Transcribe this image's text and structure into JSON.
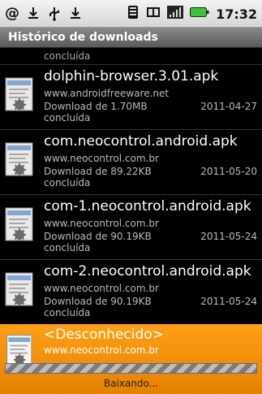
{
  "status_bar": {
    "time": "17:32",
    "left_icons": [
      "at-icon",
      "download-icon",
      "usb-icon",
      "download-icon"
    ],
    "right_icons": [
      "vibrate-icon",
      "sim-icon",
      "signal-icon",
      "battery-icon"
    ]
  },
  "title": "Histórico de downloads",
  "partial_item": {
    "state": "concluída"
  },
  "items": [
    {
      "name": "dolphin-browser.3.01.apk",
      "site": "www.androidfreeware.net",
      "size": "Download de 1.70MB",
      "date": "2011-04-27",
      "state": "concluída"
    },
    {
      "name": "com.neocontrol.android.apk",
      "site": "www.neocontrol.com.br",
      "size": "Download de 89.22KB",
      "date": "2011-05-20",
      "state": "concluída"
    },
    {
      "name": "com-1.neocontrol.android.apk",
      "site": "www.neocontrol.com.br",
      "size": "Download de 90.19KB",
      "date": "2011-05-24",
      "state": "concluída"
    },
    {
      "name": "com-2.neocontrol.android.apk",
      "site": "www.neocontrol.com.br",
      "size": "Download de 90.19KB",
      "date": "2011-05-24",
      "state": "concluída"
    }
  ],
  "active_item": {
    "name": "<Desconhecido>",
    "site": "www.neocontrol.com.br",
    "status": "Baixando..."
  },
  "colors": {
    "accent": "#ff9f15",
    "background": "#000000"
  }
}
